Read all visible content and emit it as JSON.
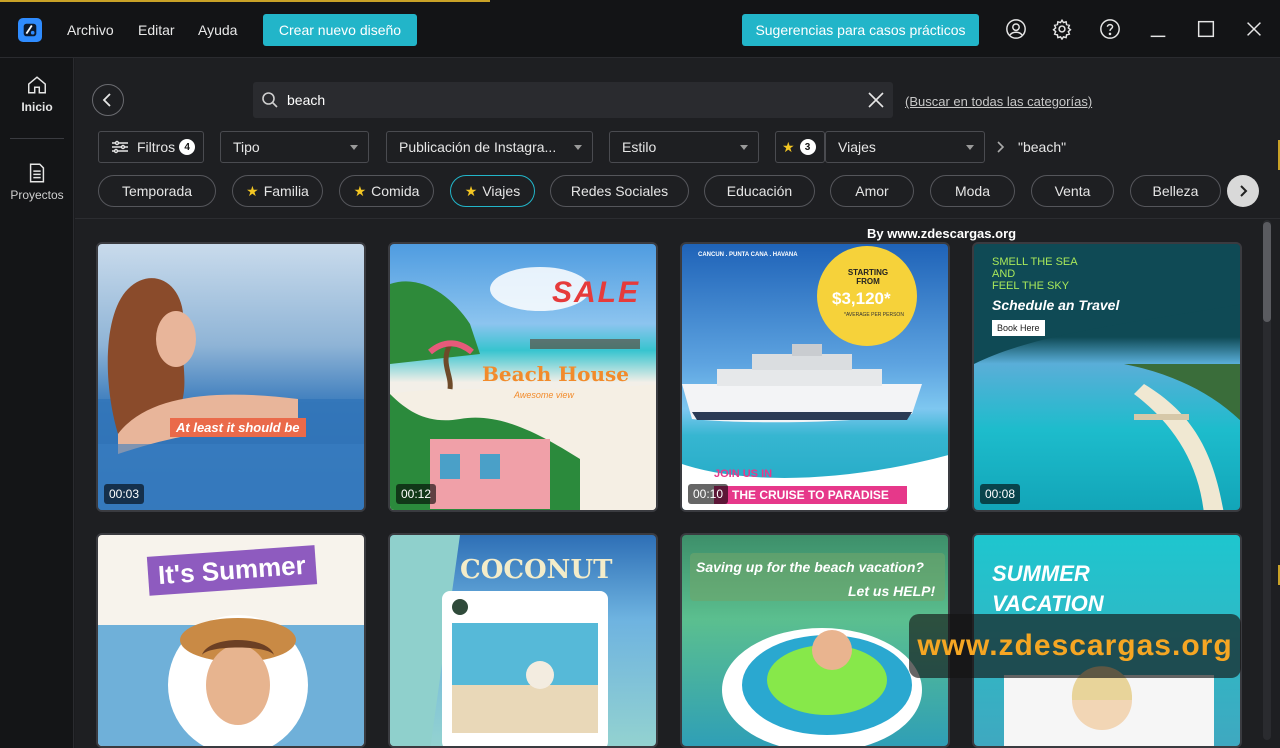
{
  "menu": {
    "file": "Archivo",
    "edit": "Editar",
    "help": "Ayuda"
  },
  "toolbar": {
    "create": "Crear nuevo diseño",
    "suggestions": "Sugerencias para casos prácticos"
  },
  "sidebar": {
    "home": "Inicio",
    "projects": "Proyectos"
  },
  "search": {
    "value": "beach",
    "search_all": "(Buscar en todas las categorías)"
  },
  "filters": {
    "filters_label": "Filtros",
    "filters_count": "4",
    "type": "Tipo",
    "format": "Publicación de Instagra...",
    "style": "Estilo",
    "fav_count": "3",
    "category": "Viajes",
    "query": "\"beach\""
  },
  "chips": [
    "Temporada",
    "Familia",
    "Comida",
    "Viajes",
    "Redes Sociales",
    "Educación",
    "Amor",
    "Moda",
    "Venta",
    "Belleza"
  ],
  "watermark_top": "By www.zdescargas.org",
  "watermark_big": "www.zdescargas.org",
  "cards": [
    {
      "duration": "00:03",
      "text": "At least it should be"
    },
    {
      "duration": "00:12",
      "title": "SALE",
      "subtitle": "Beach House",
      "tag": "Awesome view"
    },
    {
      "duration": "00:10",
      "top": "CANCUN . PUNTA CANA . HAVANA",
      "price_label": "STARTING FROM",
      "price": "$3,120*",
      "price_note": "*AVERAGE PER PERSON",
      "join": "JOIN US IN",
      "cta": "THE CRUISE TO PARADISE"
    },
    {
      "duration": "00:08",
      "line1": "SMELL THE SEA",
      "line2": "AND",
      "line3": "FEEL THE SKY",
      "headline": "Schedule an Travel",
      "button": "Book Here"
    },
    {
      "title": "It's Summer"
    },
    {
      "title": "COCONUT"
    },
    {
      "line1": "Saving up for the beach vacation?",
      "line2": "Let us HELP!"
    },
    {
      "line1": "SUMMER",
      "line2": "VACATION"
    }
  ]
}
